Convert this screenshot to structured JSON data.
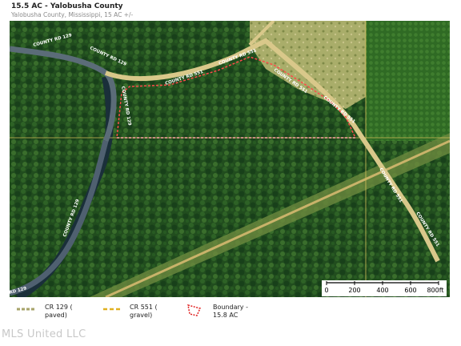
{
  "header": {
    "title": "15.5 AC - Yalobusha County",
    "subtitle": "Yalobusha County, Mississippi, 15 AC +/-"
  },
  "map": {
    "road_labels": {
      "cr129_a": "COUNTY RD 129",
      "cr129_b": "COUNTY RD 129",
      "cr129_c": "COUNTY RD 129",
      "cr129_d": "COUNTY RD 129",
      "cr129_e": "RD 129",
      "cr551_a": "COUNTY RD 551",
      "cr551_b": "COUNTY RD 551",
      "cr551_c": "COUNTY RD 551",
      "cr551_d": "COUNTY RD 551",
      "cr551_e": "COUNTY RD 551",
      "cr551_f": "COUNTY RD 551",
      "cr551_g": "COUNTY RD 551"
    },
    "colors": {
      "forest": "#1f4a1c",
      "paved_road": "#3a4a5a",
      "gravel_road": "#e0c860",
      "boundary": "#ff3b3b",
      "clearing": "#b8b870"
    }
  },
  "scale": {
    "ticks": [
      "0",
      "200",
      "400",
      "600",
      "800ft"
    ]
  },
  "legend": {
    "paved": {
      "label_line1": "CR 129  (",
      "label_line2": "paved)"
    },
    "gravel": {
      "label_line1": "CR 551  (",
      "label_line2": "gravel)"
    },
    "boundary": {
      "label_line1": "Boundary  -",
      "label_line2": "15.8 AC"
    }
  },
  "watermark": "MLS United LLC"
}
